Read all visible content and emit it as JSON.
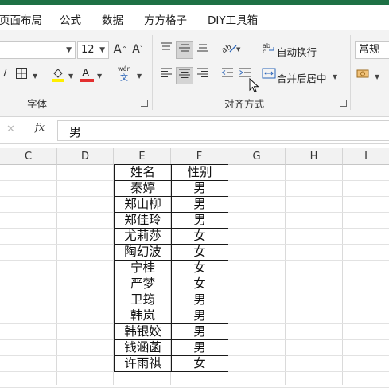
{
  "menu": [
    "页面布局",
    "公式",
    "数据",
    "方方格子",
    "DIY工具箱"
  ],
  "font": {
    "size": "12",
    "grow_label": "A",
    "shrink_label": "A",
    "group_label": "字体",
    "pinyin_label": "wén"
  },
  "alignment": {
    "wrap_label": "自动换行",
    "merge_label": "合并后居中",
    "group_label": "对齐方式"
  },
  "number": {
    "format": "常规"
  },
  "formula_bar": {
    "cancel": "✓",
    "fx": "fx",
    "value": "男"
  },
  "columns": [
    "C",
    "D",
    "E",
    "F",
    "G",
    "H",
    "I"
  ],
  "table": {
    "headers": [
      "姓名",
      "性别"
    ],
    "rows": [
      [
        "秦婷",
        "男"
      ],
      [
        "郑山柳",
        "男"
      ],
      [
        "郑佳玲",
        "男"
      ],
      [
        "尤莉莎",
        "女"
      ],
      [
        "陶幻波",
        "女"
      ],
      [
        "宁桂",
        "女"
      ],
      [
        "严梦",
        "女"
      ],
      [
        "卫筠",
        "男"
      ],
      [
        "韩岚",
        "男"
      ],
      [
        "韩银姣",
        "男"
      ],
      [
        "钱涵菡",
        "男"
      ],
      [
        "许雨祺",
        "女"
      ]
    ]
  }
}
